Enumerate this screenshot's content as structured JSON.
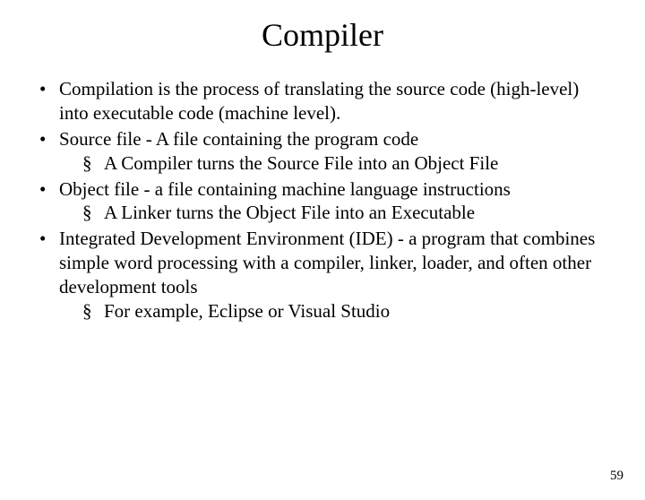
{
  "title": "Compiler",
  "bullets": [
    {
      "text": "Compilation is the process of translating the source code (high-level) into executable code (machine level).",
      "sub": []
    },
    {
      "text": "Source file - A file containing the program code",
      "sub": [
        "A Compiler turns the Source File into an Object File"
      ]
    },
    {
      "text": "Object file - a file containing machine language instructions",
      "sub": [
        "A Linker turns the Object File into an Executable"
      ]
    },
    {
      "text": "Integrated Development Environment (IDE) - a program that combines simple word processing with a compiler, linker, loader, and often other development tools",
      "sub": [
        "For example, Eclipse or Visual Studio"
      ]
    }
  ],
  "page_number": "59"
}
